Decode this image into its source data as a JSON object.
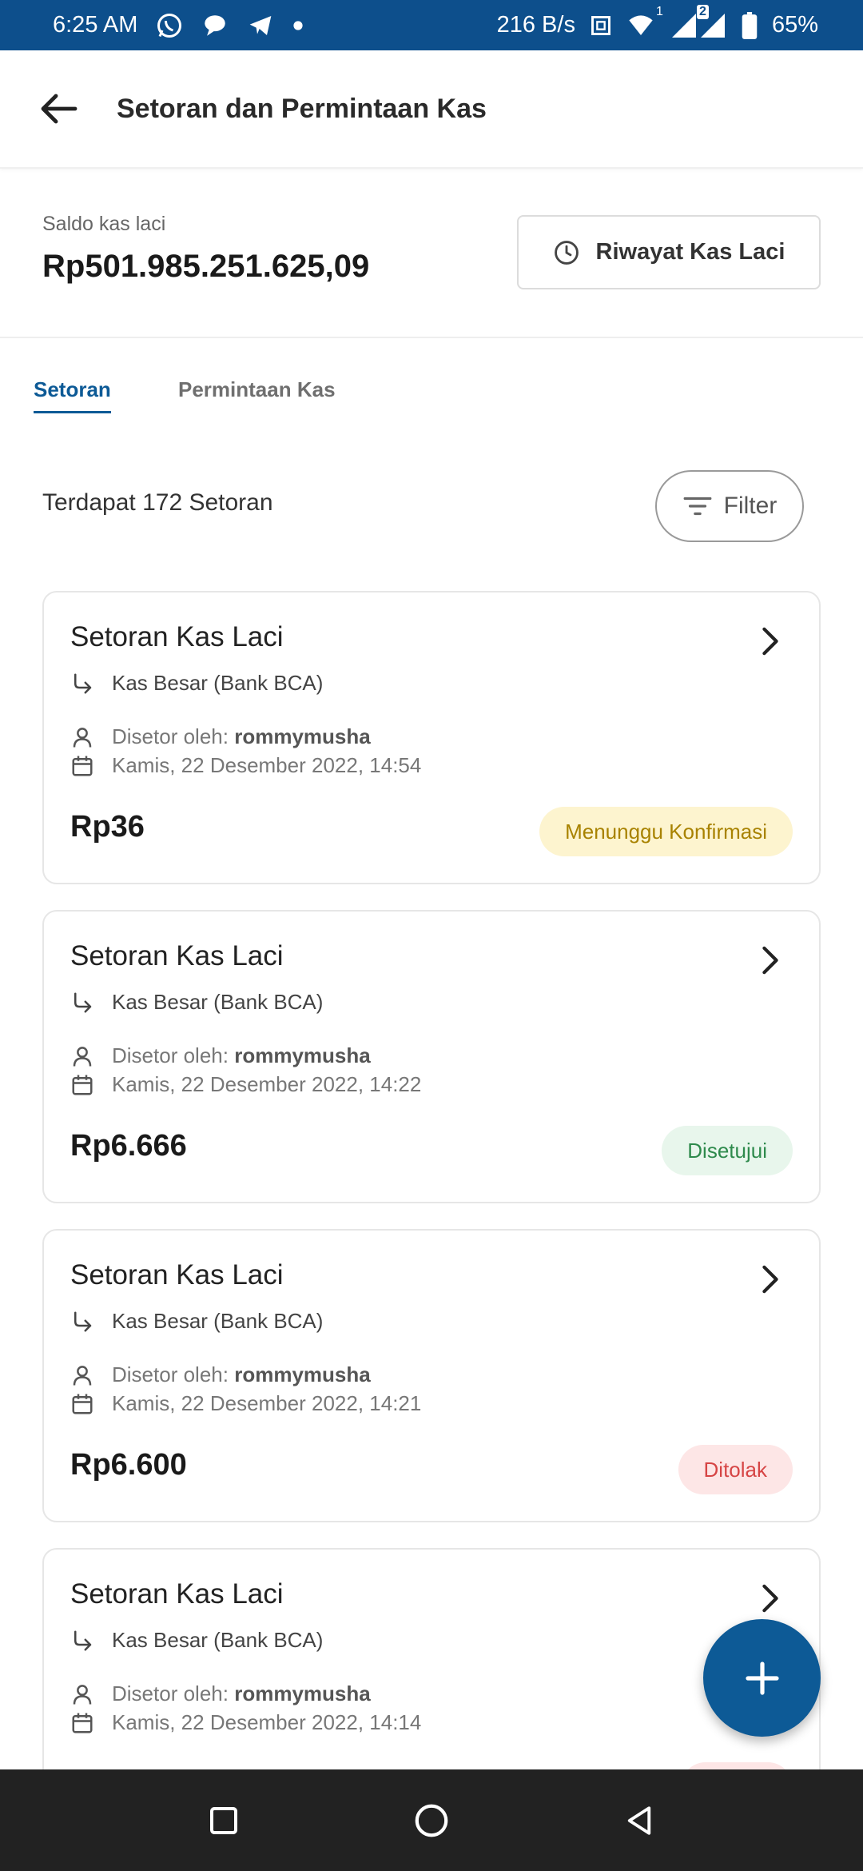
{
  "status_bar": {
    "time": "6:25 AM",
    "speed": "216 B/s",
    "battery": "65%",
    "sim1": "1",
    "sim2": "2",
    "icons": [
      "whatsapp-icon",
      "chat-icon",
      "telegram-icon",
      "dot-icon",
      "nfc-icon",
      "wifi-icon",
      "signal-icon",
      "battery-icon"
    ]
  },
  "header": {
    "title": "Setoran dan Permintaan Kas",
    "back_icon": "arrow-left-icon"
  },
  "balance": {
    "label": "Saldo kas laci",
    "amount": "Rp501.985.251.625,09",
    "history_button": "Riwayat Kas Laci"
  },
  "tabs": [
    {
      "label": "Setoran",
      "active": true
    },
    {
      "label": "Permintaan Kas",
      "active": false
    }
  ],
  "list": {
    "count_text": "Terdapat 172 Setoran",
    "filter_label": "Filter",
    "by_label": "Disetor oleh:",
    "items": [
      {
        "title": "Setoran Kas Laci",
        "destination": "Kas Besar (Bank BCA)",
        "user": "rommymusha",
        "datetime": "Kamis, 22 Desember 2022, 14:54",
        "amount": "Rp36",
        "status": "Menunggu Konfirmasi"
      },
      {
        "title": "Setoran Kas Laci",
        "destination": "Kas Besar (Bank BCA)",
        "user": "rommymusha",
        "datetime": "Kamis, 22 Desember 2022, 14:22",
        "amount": "Rp6.666",
        "status": "Disetujui"
      },
      {
        "title": "Setoran Kas Laci",
        "destination": "Kas Besar (Bank BCA)",
        "user": "rommymusha",
        "datetime": "Kamis, 22 Desember 2022, 14:21",
        "amount": "Rp6.600",
        "status": "Ditolak"
      },
      {
        "title": "Setoran Kas Laci",
        "destination": "Kas Besar (Bank BCA)",
        "user": "rommymusha",
        "datetime": "Kamis, 22 Desember 2022, 14:14"
      }
    ]
  },
  "colors": {
    "primary": "#0d5a96",
    "status_bar": "#0d4f8c",
    "pending_bg": "#fdf4cf",
    "pending_text": "#a88200",
    "approved_bg": "#e8f6ec",
    "approved_text": "#2e8a4c",
    "rejected_bg": "#fde6e6",
    "rejected_text": "#d64545"
  },
  "fab": {
    "icon": "plus-icon"
  },
  "nav": {
    "icons": [
      "recents-square-icon",
      "home-circle-icon",
      "back-triangle-icon"
    ]
  }
}
